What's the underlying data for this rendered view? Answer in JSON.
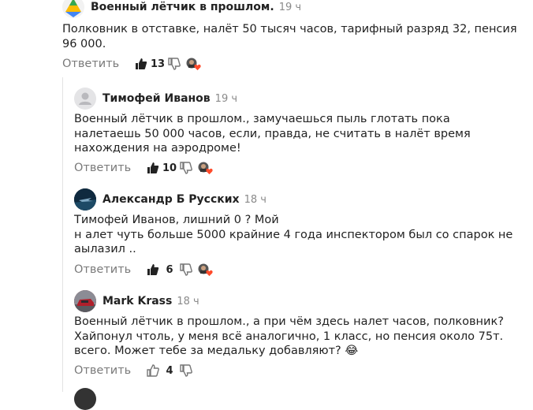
{
  "colors": {
    "text": "#222222",
    "muted": "#8a8a8a",
    "line": "#e3e3e3",
    "heart": "#ff4b2b"
  },
  "comments": [
    {
      "author": "Военный лётчик в прошлом.",
      "time": "19 ч",
      "lines": [
        "Полковник в отставке, налёт 50 тысяч часов, тарифный разряд 32, пенсия",
        "96 000."
      ],
      "reply": "Ответить",
      "likes": "13",
      "avatar_icon": "google-logo-avatar",
      "liked": true
    },
    {
      "author": "Тимофей Иванов",
      "time": "19 ч",
      "lines": [
        "Военный лётчик в прошлом., замучаешься пыль глотать пока",
        "налетаешь 50 000 часов, если, правда, не считать в налёт время",
        "нахождения на аэродроме!"
      ],
      "reply": "Ответить",
      "likes": "10",
      "avatar_icon": "default-user-avatar",
      "liked": true
    },
    {
      "author": "Александр Б Русских",
      "time": "18 ч",
      "lines": [
        "Тимофей Иванов, лишний 0 ? Мой",
        "н алет чуть больше 5000 крайние 4 года инспектором был со спарок не",
        "аылазил .."
      ],
      "reply": "Ответить",
      "likes": "6",
      "avatar_icon": "jet-photo-avatar",
      "liked": true
    },
    {
      "author": "Mark Krass",
      "time": "18 ч",
      "lines": [
        "Военный лётчик в прошлом., а при чём здесь налет часов, полковник?",
        "Хайпонул чтоль, у меня всё аналогично, 1 класс, но пенсия около 75т.",
        "всего. Может тебе за медальку добавляют? 😂"
      ],
      "reply": "Ответить",
      "likes": "4",
      "avatar_icon": "car-photo-avatar",
      "liked": false
    }
  ]
}
